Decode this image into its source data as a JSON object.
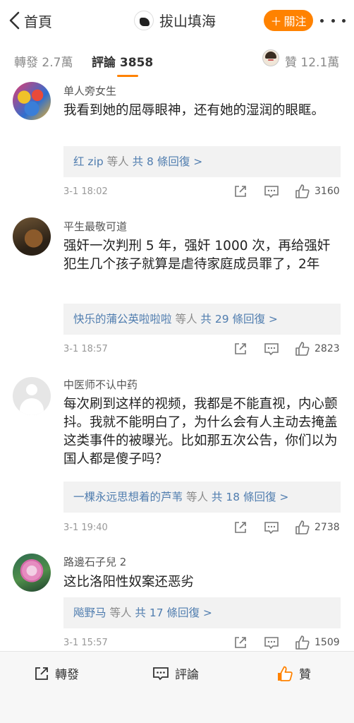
{
  "header": {
    "back_label": "首頁",
    "title": "拔山填海",
    "follow_label": "關注"
  },
  "tabs": {
    "repost_label": "轉發",
    "repost_count": "2.7萬",
    "comment_label": "評論",
    "comment_count": "3858",
    "like_label": "贊",
    "like_count": "12.1萬"
  },
  "comments": [
    {
      "name": "单人旁女生",
      "text": "我看到她的屈辱眼神，还有她的湿润的眼眶。",
      "reply_users": "红 zip",
      "reply_suffix": "等人",
      "reply_more": "共 8 條回復 >",
      "time": "3-1 18:02",
      "likes": "3160"
    },
    {
      "name": "平生最敬可道",
      "text": "强奸一次判刑 5 年，强奸 1000 次，再给强奸犯生几个孩子就算是虐待家庭成员罪了，2年",
      "reply_users": "快乐的蒲公英啦啦啦",
      "reply_suffix": "等人",
      "reply_more": "共 29 條回復 >",
      "time": "3-1 18:57",
      "likes": "2823"
    },
    {
      "name": "中医师不认中药",
      "text": "每次刷到这样的视频，我都是不能直视，内心颤抖。我就不能明白了，为什么会有人主动去掩盖这类事件的被曝光。比如那五次公告，你们以为国人都是傻子吗？",
      "reply_users": "一棵永远思想着的芦苇",
      "reply_suffix": "等人",
      "reply_more": "共 18 條回復 >",
      "time": "3-1 19:40",
      "likes": "2738"
    },
    {
      "name": "路邊石子兒 2",
      "text": "这比洛阳性奴案还恶劣",
      "reply_users": "飚野马",
      "reply_suffix": "等人",
      "reply_more": "共 17 條回復 >",
      "time": "3-1 15:57",
      "likes": "1509"
    }
  ],
  "bottom_bar": {
    "repost_label": "轉發",
    "comment_label": "評論",
    "like_label": "贊"
  },
  "colors": {
    "accent": "#ff8200",
    "link": "#507daf"
  }
}
